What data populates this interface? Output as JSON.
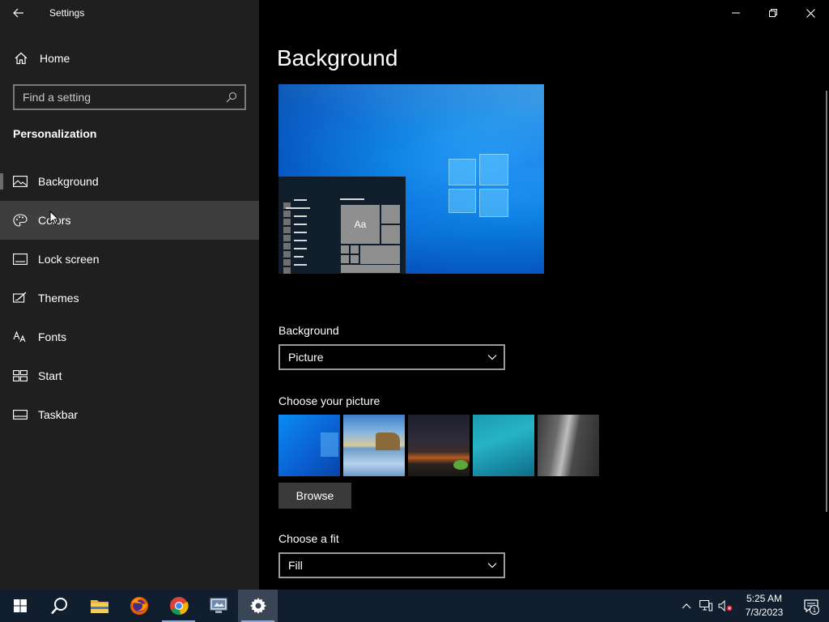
{
  "window": {
    "title": "Settings"
  },
  "sidebar": {
    "home_label": "Home",
    "search_placeholder": "Find a setting",
    "section_title": "Personalization",
    "items": [
      {
        "label": "Background",
        "icon": "picture-icon",
        "selected": true
      },
      {
        "label": "Colors",
        "icon": "palette-icon",
        "hover": true
      },
      {
        "label": "Lock screen",
        "icon": "lock-screen-icon"
      },
      {
        "label": "Themes",
        "icon": "themes-icon"
      },
      {
        "label": "Fonts",
        "icon": "fonts-icon"
      },
      {
        "label": "Start",
        "icon": "start-icon"
      },
      {
        "label": "Taskbar",
        "icon": "taskbar-icon"
      }
    ]
  },
  "main": {
    "page_title": "Background",
    "preview_tile_text": "Aa",
    "background_label": "Background",
    "background_value": "Picture",
    "choose_picture_label": "Choose your picture",
    "browse_label": "Browse",
    "fit_label": "Choose a fit",
    "fit_value": "Fill"
  },
  "taskbar": {
    "apps": [
      "start-icon",
      "search-icon",
      "file-explorer-icon",
      "firefox-icon",
      "chrome-icon",
      "control-panel-icon",
      "settings-icon"
    ],
    "clock_time": "5:25 AM",
    "clock_date": "7/3/2023",
    "notification_count": "1"
  },
  "colors": {
    "sidebar_bg": "#1f1f1f",
    "main_bg": "#000000",
    "taskbar_bg": "#101e2e",
    "hover_bg": "#3e3e3e"
  }
}
